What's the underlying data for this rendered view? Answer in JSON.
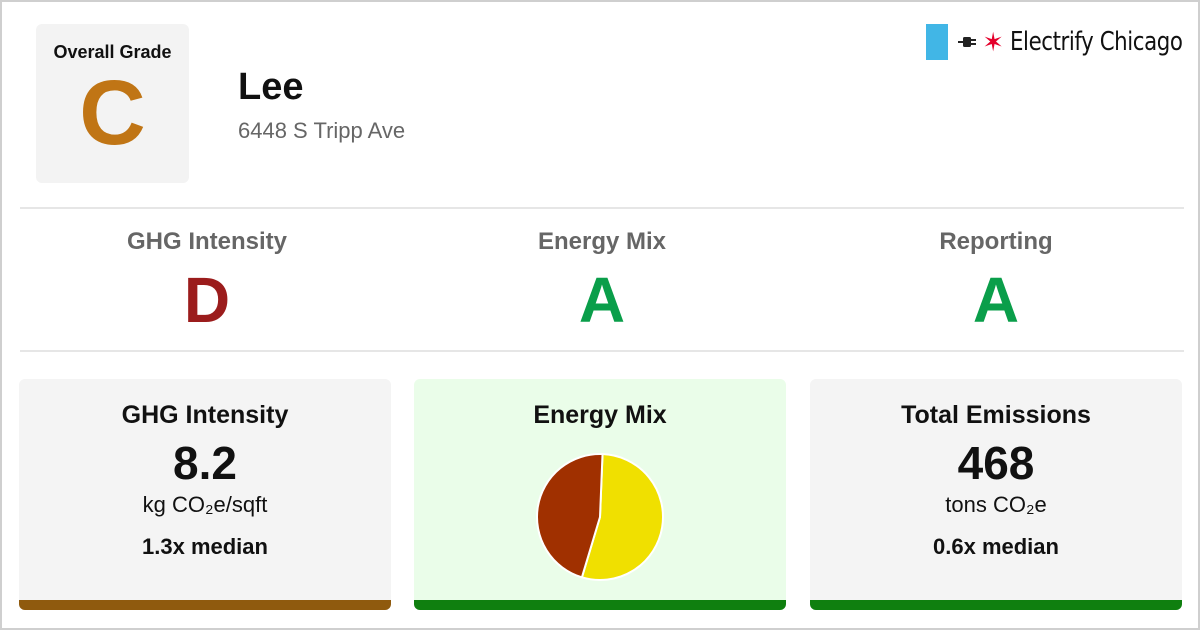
{
  "overall": {
    "label": "Overall Grade",
    "grade": "C",
    "color": "#c07515"
  },
  "building": {
    "name": "Lee",
    "address": "6448 S Tripp Ave"
  },
  "brand": {
    "text": "Electrify Chicago",
    "flag_color": "#41b6e6",
    "star_color": "#e4002b",
    "icons": [
      "plug-icon",
      "star-icon"
    ]
  },
  "grades": [
    {
      "label": "GHG Intensity",
      "grade": "D",
      "color": "#9b1c1c"
    },
    {
      "label": "Energy Mix",
      "grade": "A",
      "color": "#0a9e4a"
    },
    {
      "label": "Reporting",
      "grade": "A",
      "color": "#0a9e4a"
    }
  ],
  "cards": {
    "ghg": {
      "title": "GHG Intensity",
      "value": "8.2",
      "unit": "kg CO₂e/sqft",
      "median": "1.3x median",
      "bar_color": "#8f5a0e",
      "bg": "#f4f4f4"
    },
    "mix": {
      "title": "Energy Mix",
      "bar_color": "#0f7f0f",
      "bg": "#eafde9"
    },
    "total": {
      "title": "Total Emissions",
      "value": "468",
      "unit": "tons CO₂e",
      "median": "0.6x median",
      "bar_color": "#0f7f0f",
      "bg": "#f4f4f4"
    }
  },
  "chart_data": {
    "type": "pie",
    "slices": [
      {
        "value": 54,
        "color": "#f0e000"
      },
      {
        "value": 46,
        "color": "#a03000"
      }
    ]
  }
}
